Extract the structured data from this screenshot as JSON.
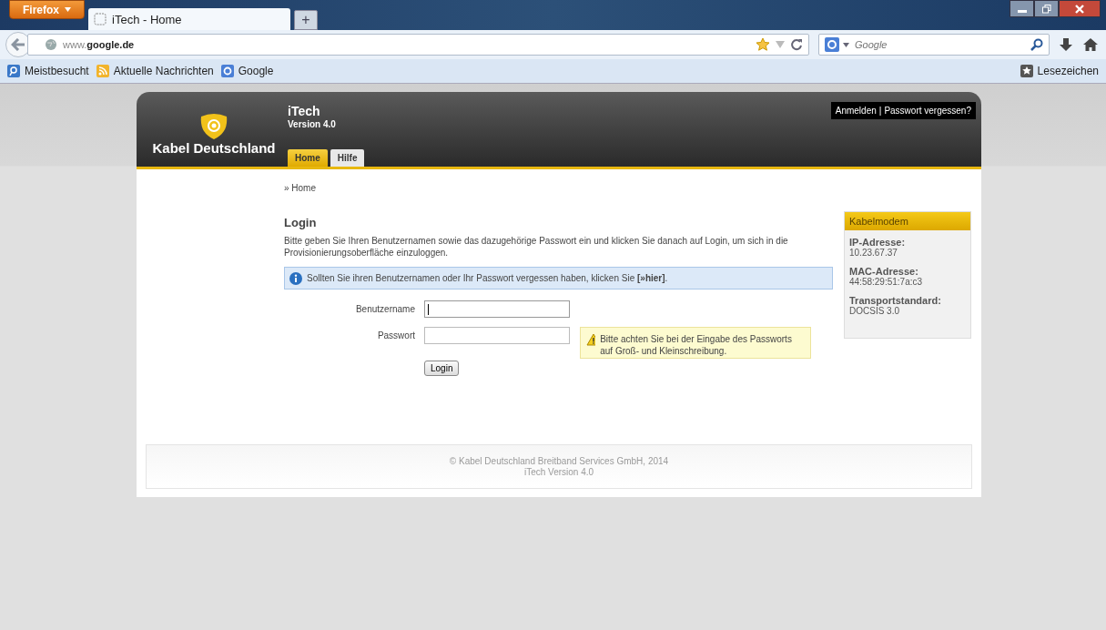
{
  "browser": {
    "menu_button": "Firefox",
    "tabs": [
      {
        "title": "iTech - Home",
        "selected": true
      }
    ],
    "new_tab": "+",
    "url": "www.**google.de**",
    "search_placeholder": "Google",
    "bookmarks": [
      {
        "label": "Meistbesucht",
        "kind": "folder"
      },
      {
        "label": "Aktuelle Nachrichten",
        "kind": "feed"
      },
      {
        "label": "Google",
        "kind": "google"
      }
    ],
    "bookmarks_menu": "Lesezeichen"
  },
  "site": {
    "logo_text": "Kabel Deutschland",
    "app_title": "iTech",
    "version": "Version 4.0",
    "nav": [
      {
        "label": "Home",
        "selected": true
      },
      {
        "label": "Hilfe",
        "selected": false
      }
    ],
    "account_links": [
      "Anmelden",
      "Passwort vergessen?"
    ],
    "account_separator": "|"
  },
  "breadcrumb": "» Home",
  "login": {
    "heading": "Login",
    "intro": "Bitte geben Sie Ihren Benutzernamen sowie das dazugehörige Passwort ein und klicken Sie danach auf Login, um sich in die Provisionierungsoberfläche einzuloggen.",
    "info": {
      "text": "Sollten Sie ihren Benutzernamen oder Ihr Passwort vergessen haben, klicken Sie",
      "link": "[»hier]",
      "suffix": "."
    },
    "fields": [
      {
        "label": "Benutzername",
        "focused": true
      },
      {
        "label": "Passwort",
        "focused": false
      }
    ],
    "warning": "Bitte achten Sie bei der Eingabe des Passworts auf Groß- und Kleinschreibung.",
    "submit": "Login"
  },
  "sidebar": {
    "title": "Kabelmodem",
    "items": [
      {
        "label": "IP-Adresse:",
        "value": "10.23.67.37"
      },
      {
        "label": "MAC-Adresse:",
        "value": "44:58:29:51:7a:c3"
      },
      {
        "label": "Transportstandard:",
        "value": "DOCSIS 3.0"
      }
    ]
  },
  "footer": [
    "© Kabel Deutschland Breitband Services GmbH, 2014",
    "iTech Version 4.0"
  ]
}
